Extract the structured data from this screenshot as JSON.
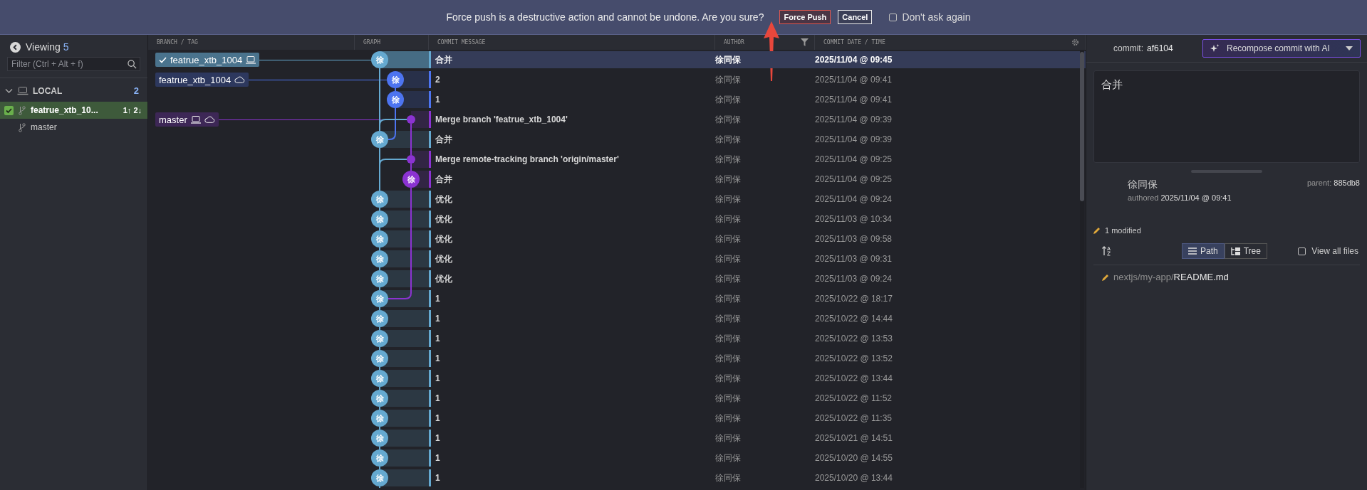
{
  "banner": {
    "message": "Force push is a destructive action and cannot be undone. Are you sure?",
    "buttons": [
      {
        "label": "Force Push",
        "kind": "danger"
      },
      {
        "label": "Cancel",
        "kind": "plain"
      }
    ],
    "dont_ask": {
      "label": "Don't ask again",
      "checked": false
    }
  },
  "sidebar": {
    "viewing_label": "Viewing",
    "viewing_count": "5",
    "filter": {
      "placeholder": "Filter (Ctrl + Alt + f)"
    },
    "section": {
      "title": "LOCAL",
      "count": "2",
      "expanded": true,
      "items": [
        {
          "name": "featrue_xtb_10...",
          "checked": true,
          "selected": true,
          "ahead_behind": "1↑ 2↓"
        },
        {
          "name": "master",
          "checked": false,
          "selected": false
        }
      ]
    }
  },
  "table": {
    "columns": [
      "BRANCH / TAG",
      "GRAPH",
      "COMMIT MESSAGE",
      "AUTHOR",
      "COMMIT DATE / TIME"
    ],
    "rows": [
      {
        "refs": [
          {
            "name": "featrue_xtb_1004",
            "current": true,
            "local": true,
            "remote": false
          }
        ],
        "kind": "avatar",
        "initial": "徐",
        "color": "#65a9d0",
        "message": "合并",
        "author": "徐同保",
        "date": "2025/11/04 @ 09:45",
        "selected": true
      },
      {
        "refs": [
          {
            "name": "featrue_xtb_1004",
            "current": false,
            "local": false,
            "remote": true
          }
        ],
        "kind": "avatar",
        "initial": "徐",
        "color": "#4d74f0",
        "message": "2",
        "author": "徐同保",
        "date": "2025/11/04 @ 09:41",
        "selected": false
      },
      {
        "kind": "avatar",
        "initial": "徐",
        "color": "#4d74f0",
        "message": "1",
        "author": "徐同保",
        "date": "2025/11/04 @ 09:41",
        "selected": false
      },
      {
        "refs": [
          {
            "name": "master",
            "current": false,
            "local": true,
            "remote": true
          }
        ],
        "kind": "dot",
        "color": "#8b33d1",
        "message": "Merge branch 'featrue_xtb_1004'",
        "author": "徐同保",
        "date": "2025/11/04 @ 09:39",
        "selected": false
      },
      {
        "kind": "avatar",
        "initial": "徐",
        "color": "#65a9d0",
        "message": "合并",
        "author": "徐同保",
        "date": "2025/11/04 @ 09:39",
        "selected": false
      },
      {
        "kind": "dot",
        "color": "#8b33d1",
        "message": "Merge remote-tracking branch 'origin/master'",
        "author": "徐同保",
        "date": "2025/11/04 @ 09:25",
        "selected": false
      },
      {
        "kind": "avatar",
        "initial": "徐",
        "color": "#8b33d1",
        "message": "合并",
        "author": "徐同保",
        "date": "2025/11/04 @ 09:25",
        "selected": false
      },
      {
        "kind": "avatar",
        "initial": "徐",
        "color": "#65a9d0",
        "message": "优化",
        "author": "徐同保",
        "date": "2025/11/04 @ 09:24",
        "selected": false
      },
      {
        "kind": "avatar",
        "initial": "徐",
        "color": "#65a9d0",
        "message": "优化",
        "author": "徐同保",
        "date": "2025/11/03 @ 10:34",
        "selected": false
      },
      {
        "kind": "avatar",
        "initial": "徐",
        "color": "#65a9d0",
        "message": "优化",
        "author": "徐同保",
        "date": "2025/11/03 @ 09:58",
        "selected": false
      },
      {
        "kind": "avatar",
        "initial": "徐",
        "color": "#65a9d0",
        "message": "优化",
        "author": "徐同保",
        "date": "2025/11/03 @ 09:31",
        "selected": false
      },
      {
        "kind": "avatar",
        "initial": "徐",
        "color": "#65a9d0",
        "message": "优化",
        "author": "徐同保",
        "date": "2025/11/03 @ 09:24",
        "selected": false
      },
      {
        "kind": "avatar",
        "initial": "徐",
        "color": "#65a9d0",
        "message": "1",
        "author": "徐同保",
        "date": "2025/10/22 @ 18:17",
        "selected": false
      },
      {
        "kind": "avatar",
        "initial": "徐",
        "color": "#65a9d0",
        "message": "1",
        "author": "徐同保",
        "date": "2025/10/22 @ 14:44",
        "selected": false
      },
      {
        "kind": "avatar",
        "initial": "徐",
        "color": "#65a9d0",
        "message": "1",
        "author": "徐同保",
        "date": "2025/10/22 @ 13:53",
        "selected": false
      },
      {
        "kind": "avatar",
        "initial": "徐",
        "color": "#65a9d0",
        "message": "1",
        "author": "徐同保",
        "date": "2025/10/22 @ 13:52",
        "selected": false
      },
      {
        "kind": "avatar",
        "initial": "徐",
        "color": "#65a9d0",
        "message": "1",
        "author": "徐同保",
        "date": "2025/10/22 @ 13:44",
        "selected": false
      },
      {
        "kind": "avatar",
        "initial": "徐",
        "color": "#65a9d0",
        "message": "1",
        "author": "徐同保",
        "date": "2025/10/22 @ 11:52",
        "selected": false
      },
      {
        "kind": "avatar",
        "initial": "徐",
        "color": "#65a9d0",
        "message": "1",
        "author": "徐同保",
        "date": "2025/10/22 @ 11:35",
        "selected": false
      },
      {
        "kind": "avatar",
        "initial": "徐",
        "color": "#65a9d0",
        "message": "1",
        "author": "徐同保",
        "date": "2025/10/21 @ 14:51",
        "selected": false
      },
      {
        "kind": "avatar",
        "initial": "徐",
        "color": "#65a9d0",
        "message": "1",
        "author": "徐同保",
        "date": "2025/10/20 @ 14:55",
        "selected": false
      },
      {
        "kind": "avatar",
        "initial": "徐",
        "color": "#65a9d0",
        "message": "1",
        "author": "徐同保",
        "date": "2025/10/20 @ 13:44",
        "selected": false
      }
    ]
  },
  "details": {
    "commit_label": "commit:",
    "commit_sha": "af6104",
    "ai_button": "Recompose commit with AI",
    "message": "合并",
    "author": "徐同保",
    "authored_label": "authored",
    "authored_date": "2025/11/04 @ 09:41",
    "parent_label": "parent:",
    "parent_sha": "885db8",
    "modified": "1 modified",
    "view_modes": [
      {
        "label": "Path",
        "selected": true
      },
      {
        "label": "Tree",
        "selected": false
      }
    ],
    "view_all": {
      "label": "View all files",
      "checked": false
    },
    "files": [
      {
        "dir": "nextjs/my-app/",
        "name": "README.md"
      }
    ]
  }
}
